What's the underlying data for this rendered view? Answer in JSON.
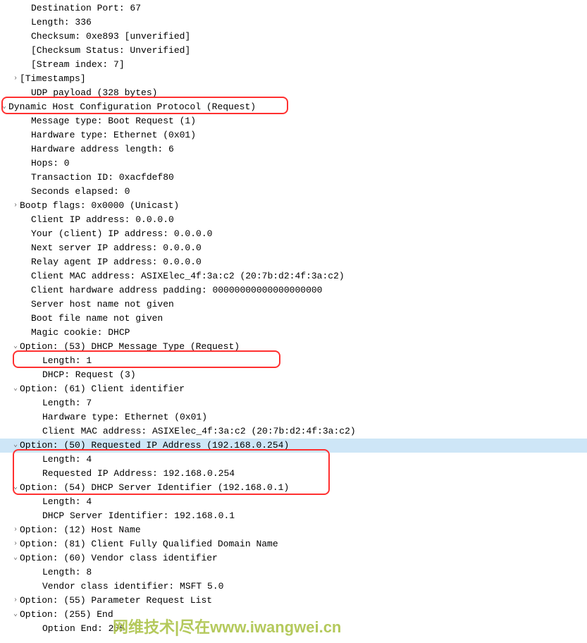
{
  "udp": {
    "dst_port": "Destination Port: 67",
    "length": "Length: 336",
    "checksum": "Checksum: 0xe893 [unverified]",
    "checksum_status": "[Checksum Status: Unverified]",
    "stream_index": "[Stream index: 7]",
    "timestamps": "[Timestamps]",
    "payload": "UDP payload (328 bytes)"
  },
  "dhcp": {
    "header": "Dynamic Host Configuration Protocol (Request)",
    "msg_type": "Message type: Boot Request (1)",
    "hw_type": "Hardware type: Ethernet (0x01)",
    "hw_len": "Hardware address length: 6",
    "hops": "Hops: 0",
    "txn_id": "Transaction ID: 0xacfdef80",
    "seconds": "Seconds elapsed: 0",
    "bootp_flags": "Bootp flags: 0x0000 (Unicast)",
    "client_ip": "Client IP address: 0.0.0.0",
    "your_ip": "Your (client) IP address: 0.0.0.0",
    "next_server": "Next server IP address: 0.0.0.0",
    "relay_agent": "Relay agent IP address: 0.0.0.0",
    "client_mac": "Client MAC address: ASIXElec_4f:3a:c2 (20:7b:d2:4f:3a:c2)",
    "client_hw_pad": "Client hardware address padding: 00000000000000000000",
    "server_host": "Server host name not given",
    "boot_file": "Boot file name not given",
    "magic_cookie": "Magic cookie: DHCP"
  },
  "opts": {
    "o53": {
      "header": "Option: (53) DHCP Message Type (Request)",
      "len": "Length: 1",
      "val": "DHCP: Request (3)"
    },
    "o61": {
      "header": "Option: (61) Client identifier",
      "len": "Length: 7",
      "hw_type": "Hardware type: Ethernet (0x01)",
      "mac": "Client MAC address: ASIXElec_4f:3a:c2 (20:7b:d2:4f:3a:c2)"
    },
    "o50": {
      "header": "Option: (50) Requested IP Address (192.168.0.254)",
      "len": "Length: 4",
      "ip": "Requested IP Address: 192.168.0.254"
    },
    "o54": {
      "header": "Option: (54) DHCP Server Identifier (192.168.0.1)",
      "len": "Length: 4",
      "val": "DHCP Server Identifier: 192.168.0.1"
    },
    "o12": {
      "header": "Option: (12) Host Name"
    },
    "o81": {
      "header": "Option: (81) Client Fully Qualified Domain Name"
    },
    "o60": {
      "header": "Option: (60) Vendor class identifier",
      "len": "Length: 8",
      "val": "Vendor class identifier: MSFT 5.0"
    },
    "o55": {
      "header": "Option: (55) Parameter Request List"
    },
    "o255": {
      "header": "Option: (255) End",
      "val": "Option End: 255"
    }
  },
  "watermark": "网维技术|尽在www.iwangwei.cn",
  "glyphs": {
    "expanded": "⌄",
    "collapsed": "›"
  }
}
